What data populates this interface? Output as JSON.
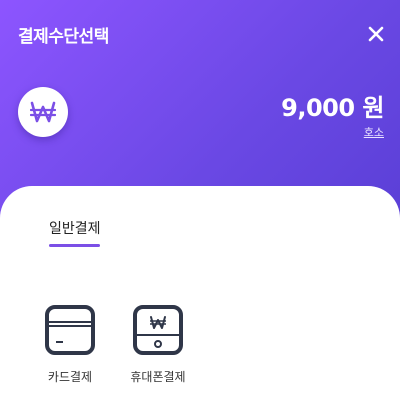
{
  "header": {
    "title": "결제수단선택",
    "amount": "9,000 원",
    "cancel_label": "호소"
  },
  "tabs": [
    {
      "label": "일반결제",
      "active": true
    }
  ],
  "payment_methods": [
    {
      "label": "카드결제",
      "icon": "credit-card-icon"
    },
    {
      "label": "휴대폰결제",
      "icon": "mobile-phone-won-icon"
    }
  ],
  "colors": {
    "header_gradient_start": "#8d55ff",
    "header_gradient_end": "#5a3fd6",
    "accent": "#7b4fe6",
    "icon_stroke": "#2f3648"
  }
}
